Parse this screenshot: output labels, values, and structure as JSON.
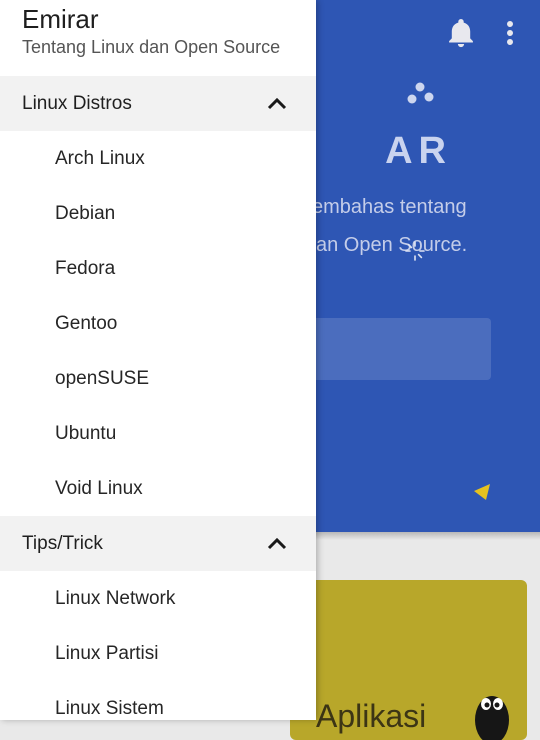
{
  "drawer": {
    "title": "Emirar",
    "subtitle": "Tentang Linux dan Open Source",
    "sections": [
      {
        "label": "Linux Distros",
        "expanded": true,
        "items": [
          "Arch Linux",
          "Debian",
          "Fedora",
          "Gentoo",
          "openSUSE",
          "Ubuntu",
          "Void Linux"
        ]
      },
      {
        "label": "Tips/Trick",
        "expanded": true,
        "items": [
          "Linux Network",
          "Linux Partisi",
          "Linux Sistem"
        ]
      }
    ]
  },
  "background": {
    "hero_title_fragment": "AR",
    "hero_desc_line1": "embahas tentang",
    "hero_desc_line2": "an Open Source.",
    "card_title_fragment": "Aplikasi"
  },
  "icons": {
    "notifications": "bell-icon",
    "overflow": "more-vert-icon",
    "logo": "dots-icon",
    "loading": "spinner-icon",
    "play": "play-icon",
    "mascot": "tux-icon",
    "collapse": "chevron-up-icon"
  },
  "colors": {
    "hero_blue": "#2e56b4",
    "card_yellow": "#b8a72a",
    "accent_yellow": "#e6c21f",
    "drawer_bg": "#ffffff",
    "section_bg": "#f2f2f2"
  }
}
